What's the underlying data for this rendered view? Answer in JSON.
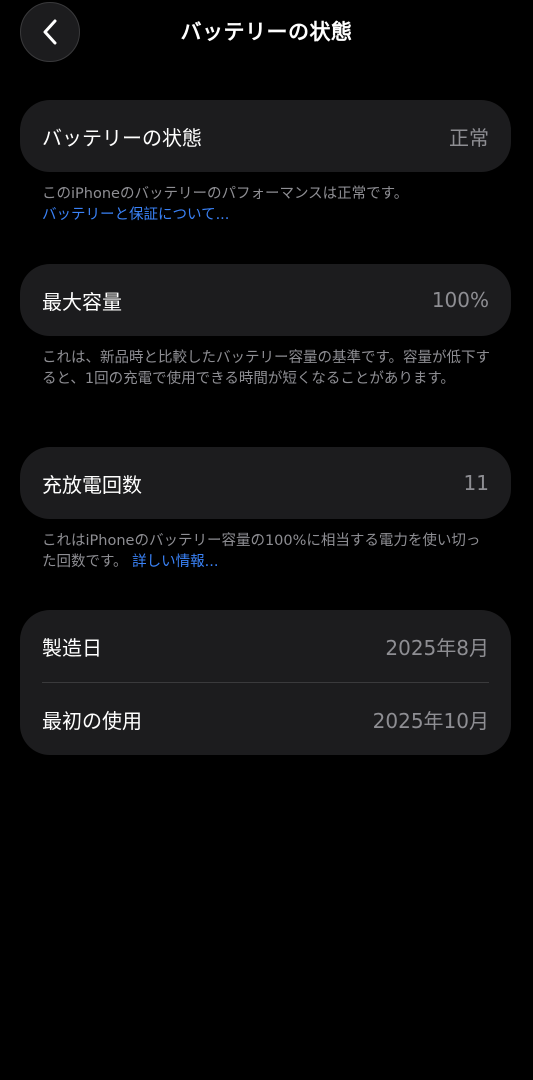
{
  "nav": {
    "title": "バッテリーの状態"
  },
  "battery_health": {
    "label": "バッテリーの状態",
    "value": "正常",
    "note": "このiPhoneのバッテリーのパフォーマンスは正常です。",
    "link": "バッテリーと保証について..."
  },
  "max_capacity": {
    "label": "最大容量",
    "value": "100%",
    "note": "これは、新品時と比較したバッテリー容量の基準です。容量が低下すると、1回の充電で使用できる時間が短くなることがあります。"
  },
  "cycle_count": {
    "label": "充放電回数",
    "value": "11",
    "note": "これはiPhoneのバッテリー容量の100%に相当する電力を使い切った回数です。",
    "link": "詳しい情報..."
  },
  "dates": {
    "manufacture_label": "製造日",
    "manufacture_value": "2025年8月",
    "first_use_label": "最初の使用",
    "first_use_value": "2025年10月"
  },
  "colors": {
    "background": "#000000",
    "card": "#1c1c1e",
    "secondary_text": "#8e8e93",
    "link": "#3a82f7"
  },
  "icons": {
    "back": "chevron-left-icon"
  }
}
